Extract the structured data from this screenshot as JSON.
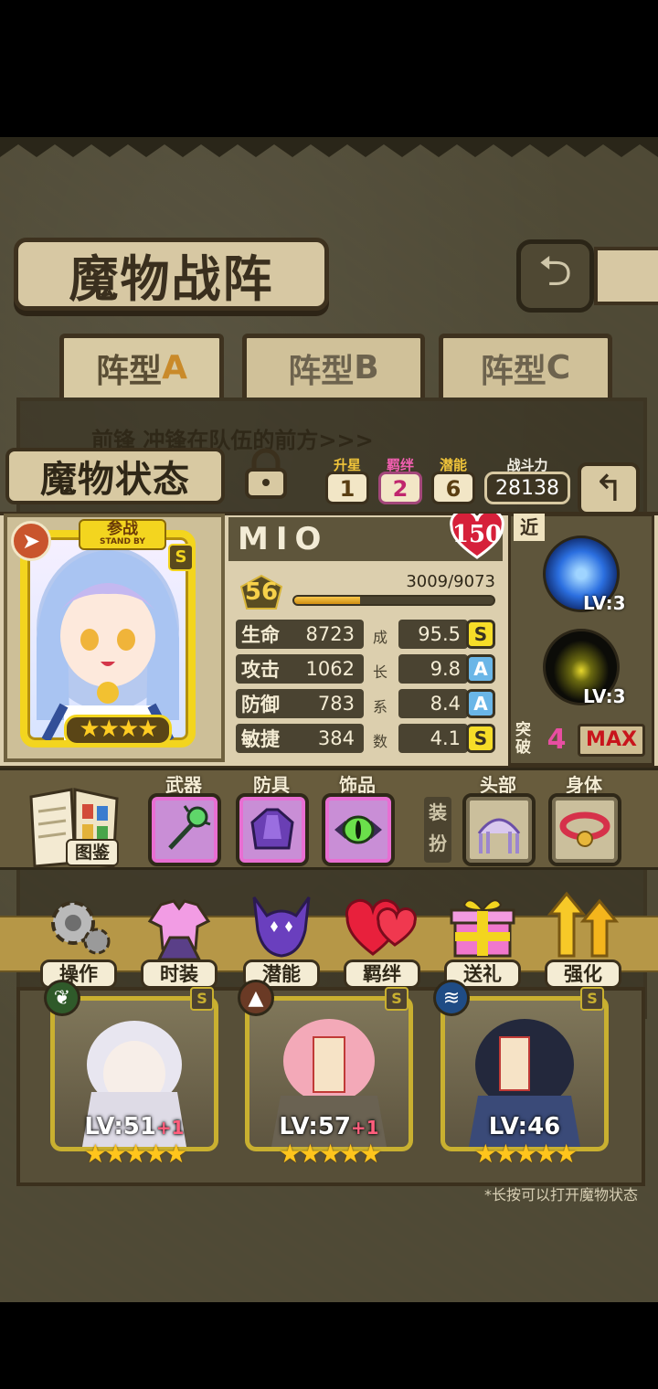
{
  "header": {
    "title": "魔物战阵",
    "back_icon": "back-arrow-icon"
  },
  "formation_tabs": [
    {
      "label_main": "阵型",
      "label_letter": "A",
      "active": true
    },
    {
      "label_main": "阵型",
      "label_letter": "B",
      "active": false
    },
    {
      "label_main": "阵型",
      "label_letter": "C",
      "active": false
    }
  ],
  "background_hint": "前锋 冲锋在队伍的前方>>>",
  "status": {
    "title": "魔物状态",
    "star_up": {
      "label": "升星",
      "value": "1"
    },
    "bond": {
      "label": "羁绊",
      "value": "2"
    },
    "potential": {
      "label": "潜能",
      "value": "6"
    },
    "power": {
      "label": "战斗力",
      "value": "28138"
    }
  },
  "monster": {
    "name": "MIO",
    "affection": "150",
    "standby_cn": "参战",
    "standby_en": "STAND BY",
    "rank": "S",
    "stars": "★★★★",
    "level": "56",
    "exp_text": "3009/9073",
    "exp_fraction": 0.33,
    "growth_label": [
      "成",
      "长",
      "系",
      "数"
    ],
    "stats": [
      {
        "label": "生命",
        "value": "8723",
        "growth": "95.5",
        "grade": "S"
      },
      {
        "label": "攻击",
        "value": "1062",
        "growth": "9.8",
        "grade": "A"
      },
      {
        "label": "防御",
        "value": "783",
        "growth": "8.4",
        "grade": "A"
      },
      {
        "label": "敏捷",
        "value": "384",
        "growth": "4.1",
        "grade": "S"
      }
    ]
  },
  "skills": {
    "range_tag": "近",
    "items": [
      {
        "level": "LV:3"
      },
      {
        "level": "LV:3"
      }
    ],
    "breakthrough_label": "突破",
    "breakthrough_value": "4",
    "max_label": "MAX"
  },
  "equipment": {
    "book_label": "图鉴",
    "slots": [
      {
        "label": "武器",
        "icon": "staff-icon"
      },
      {
        "label": "防具",
        "icon": "armor-icon"
      },
      {
        "label": "饰品",
        "icon": "amulet-icon"
      }
    ],
    "wear_label": "装扮",
    "wear_slots": [
      {
        "label": "头部",
        "icon": "headpiece-icon"
      },
      {
        "label": "身体",
        "icon": "collar-icon"
      }
    ]
  },
  "actions": [
    {
      "label": "操作",
      "icon": "gear-icon"
    },
    {
      "label": "时装",
      "icon": "outfit-icon"
    },
    {
      "label": "潜能",
      "icon": "demon-icon"
    },
    {
      "label": "羁绊",
      "icon": "hearts-icon"
    },
    {
      "label": "送礼",
      "icon": "gift-icon"
    },
    {
      "label": "强化",
      "icon": "upgrade-arrows-icon"
    }
  ],
  "roster": [
    {
      "level": "LV:51",
      "plus": "+1",
      "stars": "★★★★★",
      "rank": "S",
      "element": "leaf-icon",
      "element_color": "#2f5a2a"
    },
    {
      "level": "LV:57",
      "plus": "+1",
      "stars": "★★★★★",
      "rank": "S",
      "element": "rock-icon",
      "element_color": "#6a3a25"
    },
    {
      "level": "LV:46",
      "plus": "",
      "stars": "★★★★★",
      "rank": "S",
      "element": "wave-icon",
      "element_color": "#1f4c85"
    }
  ],
  "footer_hint": "*长按可以打开魔物状态"
}
